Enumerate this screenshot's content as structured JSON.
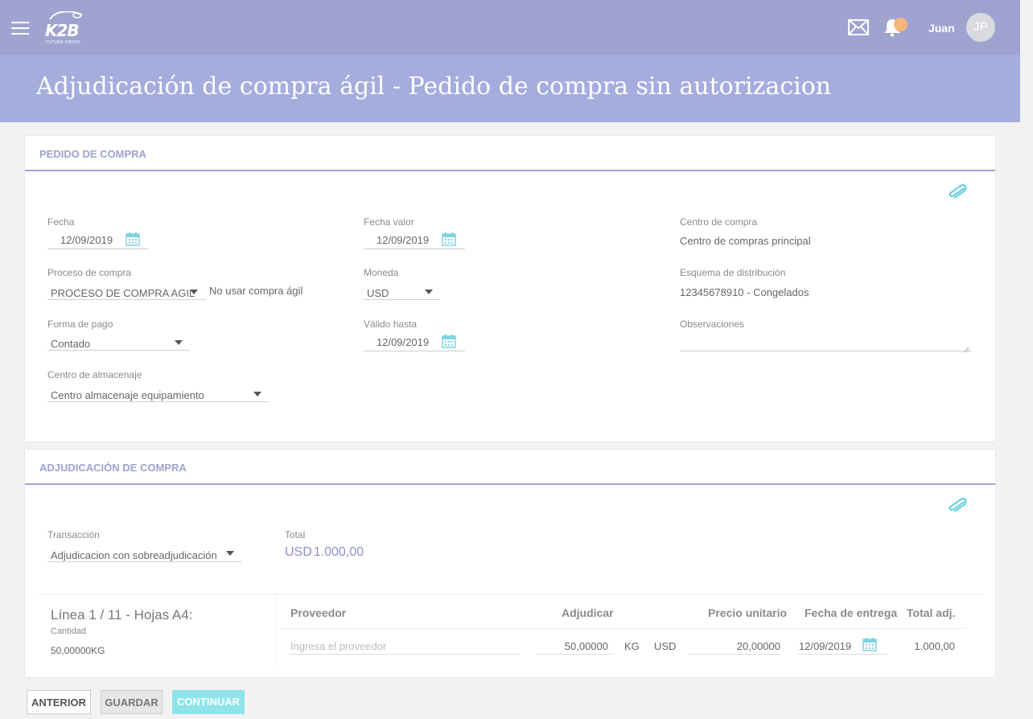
{
  "header": {
    "logo_text": "K2B",
    "logo_tagline": "FUTURE PROOF",
    "username": "Juan",
    "avatar_initials": "JP",
    "title": "Adjudicación de compra ágil - Pedido de compra sin autorizacion"
  },
  "pedido": {
    "section_title": "PEDIDO DE COMPRA",
    "fecha": {
      "label": "Fecha",
      "value": "12/09/2019"
    },
    "fecha_valor": {
      "label": "Fecha valor",
      "value": "12/09/2019"
    },
    "centro_compra": {
      "label": "Centro de compra",
      "value": "Centro de compras principal"
    },
    "proceso_compra": {
      "label": "Proceso de compra",
      "value": "PROCESO DE COMPRA AGIL",
      "note": "No usar compra ágil"
    },
    "moneda": {
      "label": "Moneda",
      "value": "USD"
    },
    "esquema": {
      "label": "Esquema de distribución",
      "value": "12345678910 - Congelados"
    },
    "forma_pago": {
      "label": "Forma de pago",
      "value": "Contado"
    },
    "valido_hasta": {
      "label": "Válido hasta",
      "value": "12/09/2019"
    },
    "observaciones": {
      "label": "Observaciones",
      "value": ""
    },
    "centro_almacenaje": {
      "label": "Centro de almacenaje",
      "value": "Centro almacenaje equipamiento"
    }
  },
  "adjudicacion": {
    "section_title": "ADJUDICACIÓN DE COMPRA",
    "transaccion": {
      "label": "Transacción",
      "value": "Adjudicacion con sobreadjudicación"
    },
    "total": {
      "label": "Total",
      "currency": "USD",
      "amount": "1.000,00"
    },
    "linea": {
      "title": "Línea 1 / 11 - Hojas A4:",
      "cantidad_label": "Cantidad",
      "cantidad_value": "50,00000",
      "cantidad_unit": "KG"
    },
    "table": {
      "headers": {
        "proveedor": "Proveedor",
        "adjudicar": "Adjudicar",
        "precio": "Precio unitario",
        "fecha": "Fecha de entrega",
        "total": "Total adj."
      },
      "row": {
        "proveedor_placeholder": "Ingresa el proveedor",
        "adjudicar": "50,00000",
        "unit": "KG",
        "currency": "USD",
        "precio": "20,00000",
        "fecha": "12/09/2019",
        "total": "1.000,00"
      }
    }
  },
  "buttons": {
    "anterior": "ANTERIOR",
    "guardar": "GUARDAR",
    "continuar": "CONTINUAR"
  }
}
